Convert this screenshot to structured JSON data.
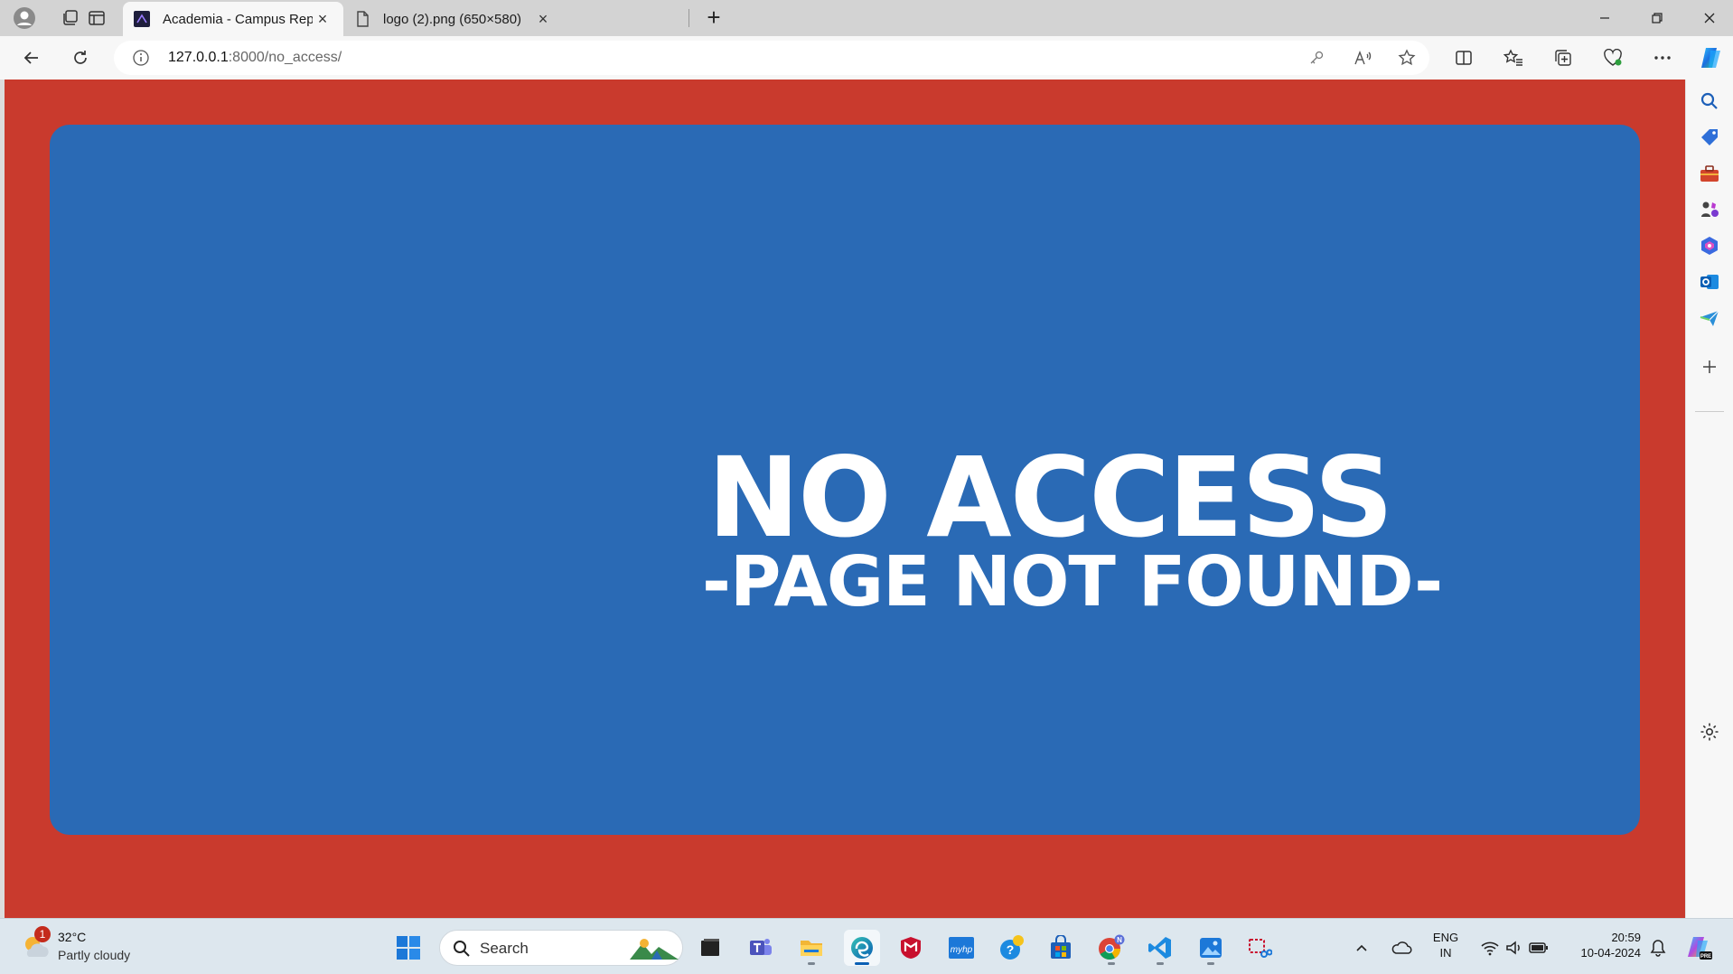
{
  "browser": {
    "tabs": [
      {
        "label": "Academia - Campus Repository",
        "active": true
      },
      {
        "label": "logo (2).png (650×580)",
        "active": false
      }
    ],
    "address": {
      "host": "127.0.0.1",
      "path": ":8000/no_access/"
    }
  },
  "page": {
    "headline": "NO ACCESS",
    "subline": "-PAGE NOT FOUND-",
    "colors": {
      "frame": "#c93a2d",
      "card": "#2a6ab5",
      "text": "#ffffff"
    }
  },
  "sidebar": {
    "icons": [
      "search-icon",
      "tag-icon",
      "toolbox-icon",
      "games-icon",
      "office-icon",
      "outlook-icon",
      "send-icon",
      "add-icon",
      "settings-icon"
    ]
  },
  "taskbar": {
    "weather": {
      "temp": "32°C",
      "desc": "Partly cloudy",
      "badge": "1"
    },
    "search_label": "Search",
    "lang": {
      "line1": "ENG",
      "line2": "IN"
    },
    "clock": {
      "time": "20:59",
      "date": "10-04-2024"
    }
  }
}
